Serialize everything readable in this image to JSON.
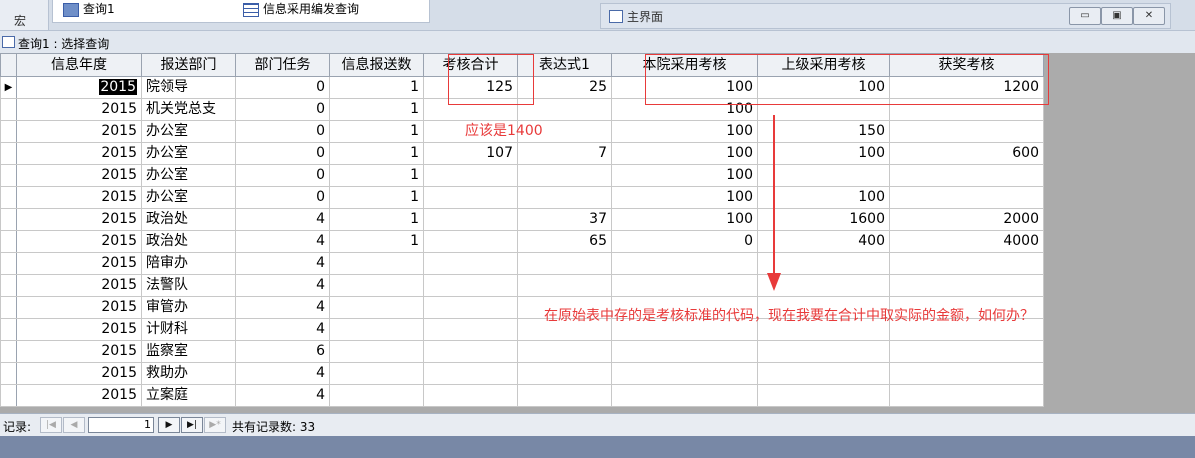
{
  "nav": {
    "side_label": "宏",
    "items": [
      {
        "label": "查询1"
      },
      {
        "label": "信息采用编发查询"
      }
    ]
  },
  "main_window": {
    "title": "主界面",
    "buttons": {
      "minimize": "▭",
      "restore": "▣",
      "close": "✕"
    }
  },
  "query_window": {
    "title": "查询1 : 选择查询"
  },
  "table": {
    "columns": [
      "信息年度",
      "报送部门",
      "部门任务",
      "信息报送数",
      "考核合计",
      "表达式1",
      "本院采用考核",
      "上级采用考核",
      "获奖考核"
    ],
    "rows": [
      [
        "2015",
        "院领导",
        "0",
        "1",
        "125",
        "25",
        "100",
        "100",
        "1200"
      ],
      [
        "2015",
        "机关党总支",
        "0",
        "1",
        "",
        "",
        "100",
        "",
        ""
      ],
      [
        "2015",
        "办公室",
        "0",
        "1",
        "",
        "",
        "100",
        "150",
        ""
      ],
      [
        "2015",
        "办公室",
        "0",
        "1",
        "107",
        "7",
        "100",
        "100",
        "600"
      ],
      [
        "2015",
        "办公室",
        "0",
        "1",
        "",
        "",
        "100",
        "",
        ""
      ],
      [
        "2015",
        "办公室",
        "0",
        "1",
        "",
        "",
        "100",
        "100",
        ""
      ],
      [
        "2015",
        "政治处",
        "4",
        "1",
        "",
        "37",
        "100",
        "1600",
        "2000"
      ],
      [
        "2015",
        "政治处",
        "4",
        "1",
        "",
        "65",
        "0",
        "400",
        "4000"
      ],
      [
        "2015",
        "陪审办",
        "4",
        "",
        "",
        "",
        "",
        "",
        ""
      ],
      [
        "2015",
        "法警队",
        "4",
        "",
        "",
        "",
        "",
        "",
        ""
      ],
      [
        "2015",
        "审管办",
        "4",
        "",
        "",
        "",
        "",
        "",
        ""
      ],
      [
        "2015",
        "计财科",
        "4",
        "",
        "",
        "",
        "",
        "",
        ""
      ],
      [
        "2015",
        "监察室",
        "6",
        "",
        "",
        "",
        "",
        "",
        ""
      ],
      [
        "2015",
        "救助办",
        "4",
        "",
        "",
        "",
        "",
        "",
        ""
      ],
      [
        "2015",
        "立案庭",
        "4",
        "",
        "",
        "",
        "",
        "",
        ""
      ]
    ]
  },
  "annotations": {
    "should_be": "应该是1400",
    "question": "在原始表中存的是考核标准的代码，现在我要在合计中取实际的金额，如何办？",
    "color": "#e83a3a"
  },
  "record_nav": {
    "label": "记录:",
    "current": "1",
    "first": "|◀",
    "prev": "◀",
    "next": "▶",
    "last": "▶|",
    "new": "▶*",
    "total": "共有记录数: 33"
  }
}
